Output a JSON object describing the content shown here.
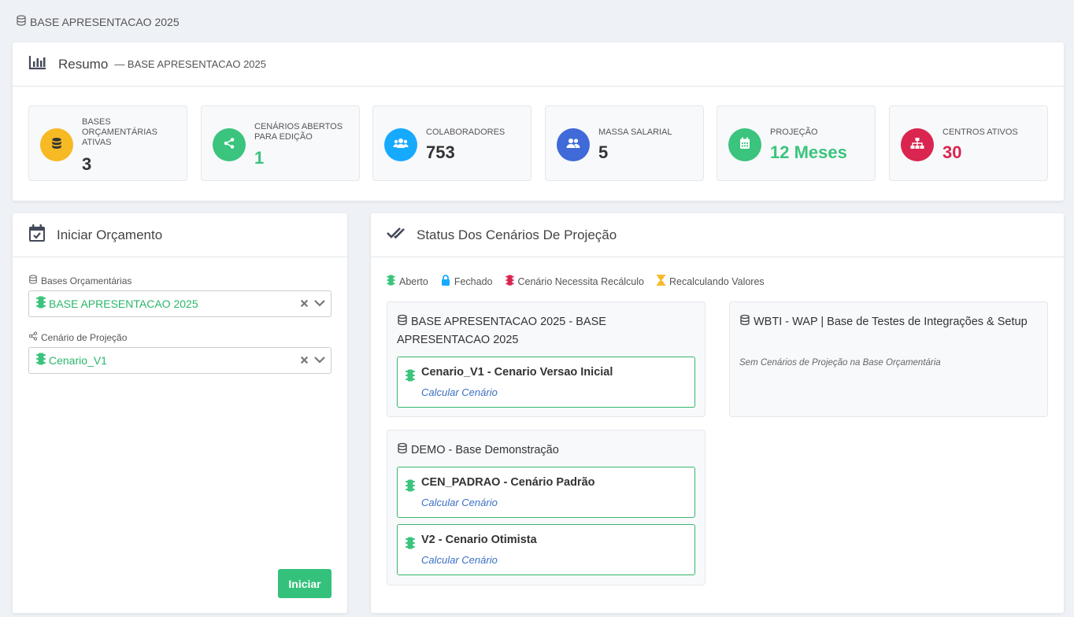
{
  "breadcrumb": {
    "label": "BASE APRESENTACAO 2025",
    "icon": "database-icon"
  },
  "summary": {
    "title": "Resumo",
    "subtitle": "— BASE APRESENTACAO 2025",
    "stats": [
      {
        "label": "Bases Orçamentárias Ativas",
        "value": "3",
        "color": "#f7b924",
        "value_color": "#333333",
        "icon": "database-icon"
      },
      {
        "label": "Cenários Abertos para Edição",
        "value": "1",
        "color": "#3ac47d",
        "value_color": "#3ac47d",
        "icon": "share-icon"
      },
      {
        "label": "Colaboradores",
        "value": "753",
        "color": "#16aaff",
        "value_color": "#333333",
        "icon": "users-icon"
      },
      {
        "label": "Massa Salarial",
        "value": "5",
        "color": "#3f6ad8",
        "value_color": "#333333",
        "icon": "user-group-icon"
      },
      {
        "label": "Projeção",
        "value": "12 Meses",
        "color": "#3ac47d",
        "value_color": "#3ac47d",
        "icon": "calendar-icon"
      },
      {
        "label": "Centros Ativos",
        "value": "30",
        "color": "#d92550",
        "value_color": "#d92550",
        "icon": "sitemap-icon"
      }
    ]
  },
  "start_budget": {
    "title": "Iniciar Orçamento",
    "bases_label": "Bases Orçamentárias",
    "bases_value": "BASE APRESENTACAO 2025",
    "scenario_label": "Cenário de Projeção",
    "scenario_value": "Cenario_V1",
    "start_button": "Iniciar"
  },
  "status": {
    "title": "Status Dos Cenários De Projeção",
    "legend": [
      {
        "label": "Aberto",
        "color": "#3ac47d",
        "icon": "traffic-light-icon"
      },
      {
        "label": "Fechado",
        "color": "#16aaff",
        "icon": "lock-icon"
      },
      {
        "label": "Cenário Necessita Recálculo",
        "color": "#d92550",
        "icon": "traffic-light-icon"
      },
      {
        "label": "Recalculando Valores",
        "color": "#f7b924",
        "icon": "hourglass-icon"
      }
    ],
    "bases": [
      {
        "title": "BASE APRESENTACAO 2025 - BASE APRESENTACAO 2025",
        "scenarios": [
          {
            "name": "Cenario_V1 - Cenario Versao Inicial",
            "link": "Calcular Cenário"
          }
        ]
      },
      {
        "title": "DEMO - Base Demonstração",
        "scenarios": [
          {
            "name": "CEN_PADRAO - Cenário Padrão",
            "link": "Calcular Cenário"
          },
          {
            "name": "V2 - Cenario Otimista",
            "link": "Calcular Cenário"
          }
        ]
      },
      {
        "title": "WBTI - WAP | Base de Testes de Integrações & Setup",
        "empty_text": "Sem Cenários de Projeção na Base Orçamentária"
      }
    ]
  }
}
